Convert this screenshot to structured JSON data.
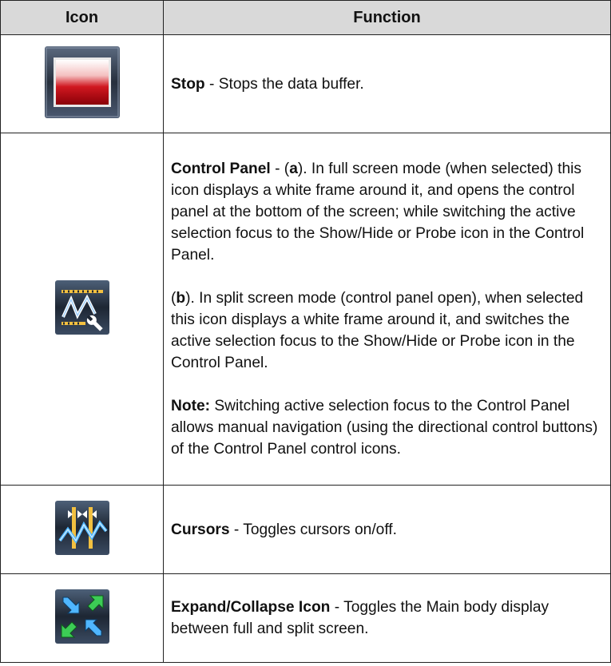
{
  "table": {
    "headers": {
      "icon": "Icon",
      "function": "Function"
    },
    "rows": {
      "stop": {
        "icon": "stop-icon",
        "title": "Stop",
        "desc": " - Stops the data buffer."
      },
      "control_panel": {
        "icon": "control-panel-icon",
        "title": "Control Panel",
        "p1_pre": " - (",
        "p1_a": "a",
        "p1_post": "). In full screen mode (when selected) this icon displays a white frame around it, and opens the control panel at the bottom of the screen; while switching the active selection focus to the Show/Hide or Probe icon in the Control Panel.",
        "p2_pre": "(",
        "p2_b": "b",
        "p2_post": "). In split screen mode (control panel open), when selected this icon displays a white frame around it, and switches the active selection focus to the Show/Hide or Probe icon in the Control Panel.",
        "note_label": "Note:",
        "note_text": " Switching active selection focus to the Control Panel allows manual navigation (using the directional control buttons) of the Control Panel control icons."
      },
      "cursors": {
        "icon": "cursors-icon",
        "title": "Cursors",
        "desc": " - Toggles cursors on/off."
      },
      "expand": {
        "icon": "expand-collapse-icon",
        "title": "Expand/Collapse Icon",
        "desc": " - Toggles the Main body display between full and split screen."
      }
    }
  },
  "colors": {
    "header_bg": "#d9d9d9",
    "icon_frame": "#3a4a5e",
    "stop_red": "#c4121c",
    "accent_blue": "#3aa0d8",
    "accent_green": "#38c850"
  }
}
